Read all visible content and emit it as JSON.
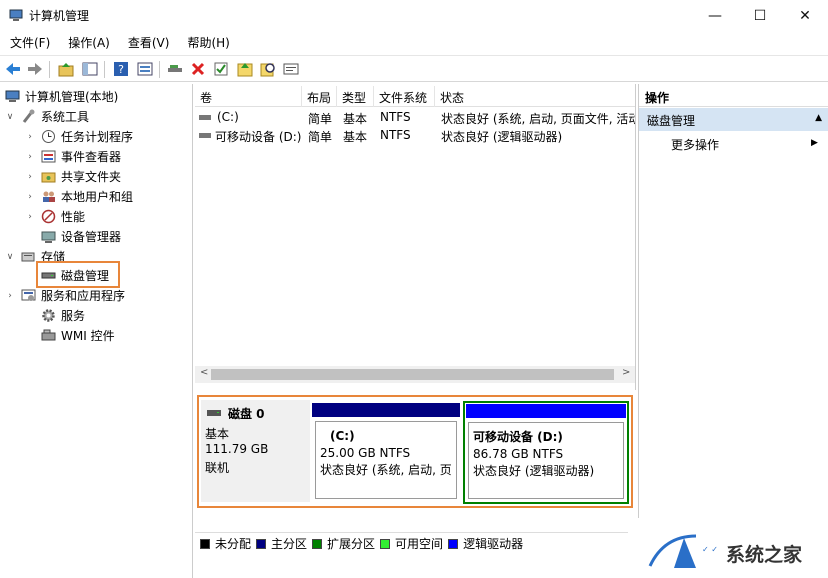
{
  "window": {
    "title": "计算机管理",
    "minimize": "—",
    "maximize": "☐",
    "close": "✕"
  },
  "menu": [
    "文件(F)",
    "操作(A)",
    "查看(V)",
    "帮助(H)"
  ],
  "toolbar": [
    "back-icon",
    "forward-icon",
    "up-folder-icon",
    "show-hide-tree-icon",
    "help-icon",
    "properties-icon",
    "connect-icon",
    "delete-icon",
    "check-icon",
    "refresh-icon",
    "search-icon",
    "export-icon"
  ],
  "tree": {
    "root": "计算机管理(本地)",
    "system_tools": "系统工具",
    "task_scheduler": "任务计划程序",
    "event_viewer": "事件查看器",
    "shared_folders": "共享文件夹",
    "local_users": "本地用户和组",
    "performance": "性能",
    "device_manager": "设备管理器",
    "storage": "存储",
    "disk_management": "磁盘管理",
    "services_apps": "服务和应用程序",
    "services": "服务",
    "wmi": "WMI 控件"
  },
  "volume_list": {
    "columns": [
      "卷",
      "布局",
      "类型",
      "文件系统",
      "状态"
    ],
    "rows": [
      {
        "volume": "(C:)",
        "layout": "简单",
        "type": "基本",
        "fs": "NTFS",
        "status": "状态良好 (系统, 启动, 页面文件, 活动"
      },
      {
        "volume": "可移动设备 (D:)",
        "layout": "简单",
        "type": "基本",
        "fs": "NTFS",
        "status": "状态良好 (逻辑驱动器)"
      }
    ]
  },
  "disk": {
    "name": "磁盘 0",
    "type": "基本",
    "size": "111.79 GB",
    "state": "联机",
    "partitions": [
      {
        "label": "(C:)",
        "size": "25.00 GB NTFS",
        "status": "状态良好 (系统, 启动, 页",
        "bar_color": "#000080"
      },
      {
        "label": "可移动设备 (D:)",
        "size": "86.78 GB NTFS",
        "status": "状态良好 (逻辑驱动器)",
        "bar_color": "#0000ff"
      }
    ]
  },
  "legend": [
    {
      "label": "未分配",
      "color": "#000000"
    },
    {
      "label": "主分区",
      "color": "#000080"
    },
    {
      "label": "扩展分区",
      "color": "#008000"
    },
    {
      "label": "可用空间",
      "color": "#33ee33"
    },
    {
      "label": "逻辑驱动器",
      "color": "#0000ff"
    }
  ],
  "actions": {
    "header": "操作",
    "section": "磁盘管理",
    "more": "更多操作"
  },
  "watermark": "系统之家",
  "colors": {
    "highlight_border": "#e8863a",
    "selected_partition_border": "#008000",
    "action_section_bg": "#d5e4f3"
  }
}
